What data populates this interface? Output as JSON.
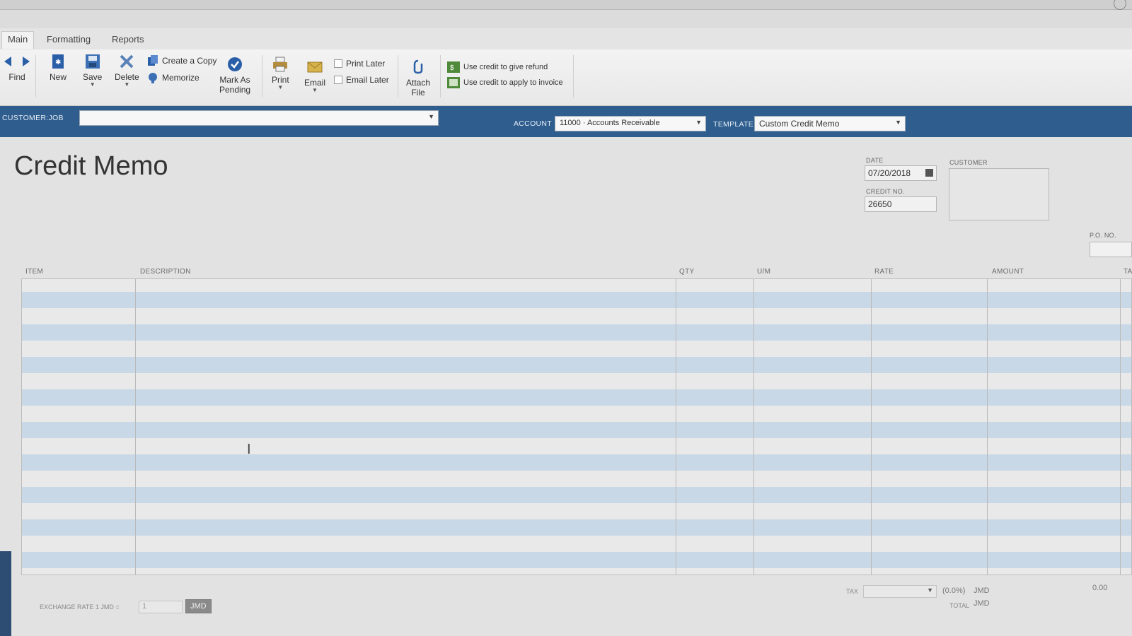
{
  "tabs": [
    "Main",
    "Formatting",
    "Reports"
  ],
  "toolbar": {
    "find": "Find",
    "new": "New",
    "save": "Save",
    "delete": "Delete",
    "create_copy": "Create a Copy",
    "memorize": "Memorize",
    "mark_as_pending_1": "Mark As",
    "mark_as_pending_2": "Pending",
    "print": "Print",
    "email": "Email",
    "print_later": "Print Later",
    "email_later": "Email Later",
    "attach_1": "Attach",
    "attach_2": "File",
    "use_credit_refund": "Use credit to give refund",
    "use_credit_invoice": "Use credit to apply to invoice"
  },
  "custbar": {
    "customer_job_label": "CUSTOMER:JOB",
    "customer_job_value": "",
    "account_label": "ACCOUNT",
    "account_value": "11000 · Accounts Receivable",
    "template_label": "TEMPLATE",
    "template_value": "Custom Credit Memo"
  },
  "form": {
    "title": "Credit Memo",
    "date_label": "DATE",
    "date_value": "07/20/2018",
    "credit_no_label": "CREDIT NO.",
    "credit_no_value": "26650",
    "customer_label": "CUSTOMER",
    "po_no_label": "P.O. NO."
  },
  "columns": {
    "item": "ITEM",
    "description": "DESCRIPTION",
    "qty": "QTY",
    "um": "U/M",
    "rate": "RATE",
    "amount": "AMOUNT",
    "tax": "TA"
  },
  "footer": {
    "exchange_rate_label": "EXCHANGE RATE 1 JMD =",
    "exchange_rate_value": "1",
    "currency_button": "JMD",
    "tax_label": "TAX",
    "tax_percent": "(0.0%)",
    "tax_currency": "JMD",
    "tax_amount": "0.00",
    "total_label": "TOTAL",
    "total_currency": "JMD"
  },
  "colors": {
    "accent_bar": "#2e5d8e",
    "row_stripe": "#c9d8e6"
  }
}
